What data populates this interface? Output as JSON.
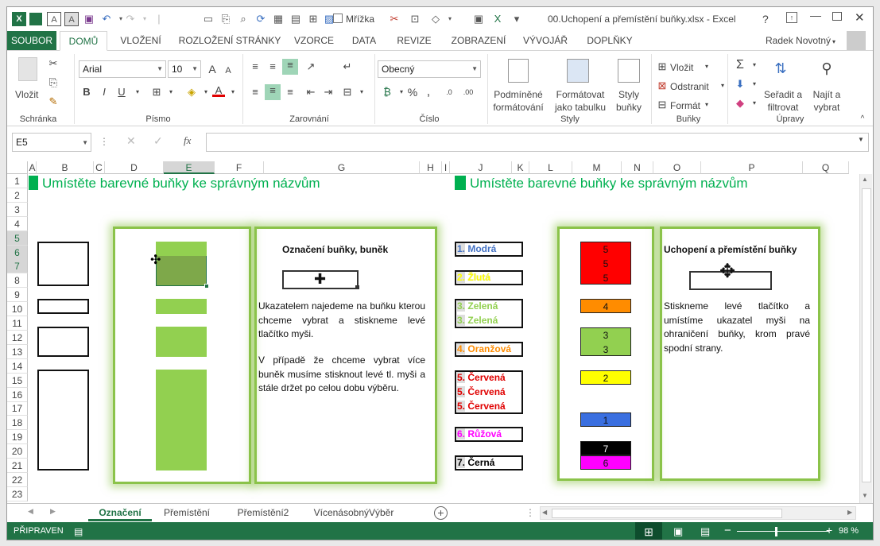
{
  "window": {
    "title": "00.Uchopení a přemístění buňky.xlsx - Excel",
    "user": "Radek Novotný",
    "help": "?",
    "gridlines_label": "Mřížka"
  },
  "ribbon_tabs": [
    "SOUBOR",
    "DOMŮ",
    "VLOŽENÍ",
    "ROZLOŽENÍ STRÁNKY",
    "VZORCE",
    "DATA",
    "REVIZE",
    "ZOBRAZENÍ",
    "VÝVOJÁŘ",
    "DOPLŇKY"
  ],
  "ribbon": {
    "paste_label": "Vložit",
    "font_name": "Arial",
    "font_size": "10",
    "number_format": "Obecný",
    "cond_format_label1": "Podmíněné",
    "cond_format_label2": "formátování",
    "format_table_label1": "Formátovat",
    "format_table_label2": "jako tabulku",
    "styles_label1": "Styly",
    "styles_label2": "buňky",
    "insert_label": "Vložit",
    "delete_label": "Odstranit",
    "format_label": "Formát",
    "sort_label1": "Seřadit a",
    "sort_label2": "filtrovat",
    "find_label1": "Najít a",
    "find_label2": "vybrat",
    "groups": [
      "Schránka",
      "Písmo",
      "Zarovnání",
      "Číslo",
      "Styly",
      "Buňky",
      "Úpravy"
    ]
  },
  "formula_bar": {
    "name_box": "E5",
    "fx": "fx",
    "formula": ""
  },
  "columns": [
    "A",
    "B",
    "C",
    "D",
    "E",
    "F",
    "G",
    "H",
    "I",
    "J",
    "K",
    "L",
    "M",
    "N",
    "O",
    "P",
    "Q"
  ],
  "rows": [
    "1",
    "2",
    "3",
    "4",
    "5",
    "6",
    "7",
    "8",
    "9",
    "10",
    "11",
    "12",
    "13",
    "14",
    "15",
    "16",
    "17",
    "18",
    "19",
    "20",
    "21",
    "22",
    "23"
  ],
  "sheet": {
    "heading_left": "Umístěte barevné buňky ke správným názvům",
    "heading_right": "Umístěte barevné buňky ke správným názvům",
    "left_title": "Označení buňky, buněk",
    "left_para1": "Ukazatelem najedeme na buňku kterou chceme vybrat a stiskneme levé tlačítko myši.",
    "left_para2": "V případě že chceme vybrat více buněk musíme stisknout levé tl. myši a stále držet po celou dobu výběru.",
    "right_title": "Uchopení a přemístění buňky",
    "right_para": "Stiskneme levé tlačítko a umístíme ukazatel myši na ohraničení buňky, krom pravé spodní strany.",
    "labels": [
      {
        "num": "1.",
        "text": "Modrá",
        "color": "#4472c4"
      },
      {
        "num": "2.",
        "text": "Žlutá",
        "color": "#ffff00"
      },
      {
        "num": "3.",
        "text": "Zelená",
        "color": "#92d050"
      },
      {
        "num": "3.",
        "text": "Zelená",
        "color": "#92d050"
      },
      {
        "num": "4.",
        "text": "Oranžová",
        "color": "#ff8c00"
      },
      {
        "num": "5.",
        "text": "Červená",
        "color": "#e00000"
      },
      {
        "num": "5.",
        "text": "Červená",
        "color": "#e00000"
      },
      {
        "num": "5.",
        "text": "Červená",
        "color": "#e00000"
      },
      {
        "num": "6.",
        "text": "Růžová",
        "color": "#ff00ff"
      },
      {
        "num": "7.",
        "text": "Černá",
        "color": "#000000"
      }
    ],
    "color_cells": [
      {
        "values": [
          "5",
          "5",
          "5"
        ],
        "color": "#ff0000"
      },
      {
        "values": [
          "4"
        ],
        "color": "#ff8c00"
      },
      {
        "values": [
          "3",
          "3"
        ],
        "color": "#92d050"
      },
      {
        "values": [
          "2"
        ],
        "color": "#ffff00"
      },
      {
        "values": [
          "1"
        ],
        "color": "#3a6fe0"
      },
      {
        "values": [
          "7"
        ],
        "color": "#000000"
      },
      {
        "values": [
          "6"
        ],
        "color": "#ff00ff"
      }
    ]
  },
  "sheet_tabs": [
    "Označení",
    "Přemístění",
    "Přemístění2",
    "VícenásobnýVýběr"
  ],
  "status": {
    "ready": "PŘIPRAVEN",
    "zoom": "98 %"
  },
  "colors": {
    "excel_green": "#217346",
    "selection_green": "#92d050"
  }
}
